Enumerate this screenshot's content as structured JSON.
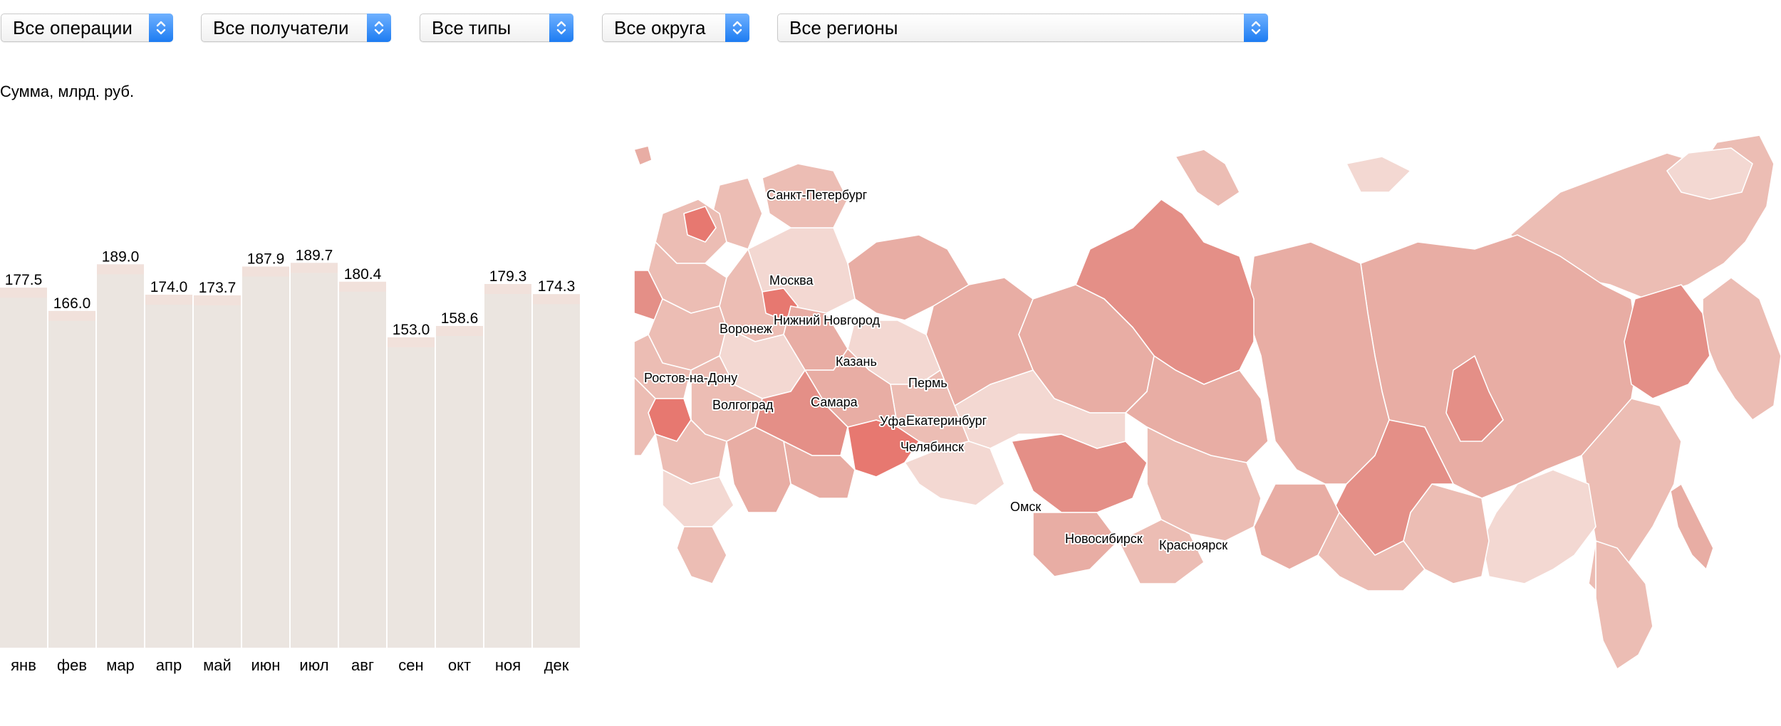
{
  "filters": {
    "operations": "Все операции",
    "recipients": "Все получатели",
    "types": "Все типы",
    "districts": "Все округа",
    "regions": "Все регионы"
  },
  "chart_data": {
    "type": "bar",
    "ylabel": "Сумма, млрд. руб.",
    "categories": [
      "янв",
      "фев",
      "мар",
      "апр",
      "май",
      "июн",
      "июл",
      "авг",
      "сен",
      "окт",
      "ноя",
      "дек"
    ],
    "values": [
      177.5,
      166.0,
      189.0,
      174.0,
      173.7,
      187.9,
      189.7,
      180.4,
      153.0,
      158.6,
      179.3,
      174.3
    ],
    "value_labels": [
      "177.5",
      "166.0",
      "189.0",
      "174.0",
      "173.7",
      "187.9",
      "189.7",
      "180.4",
      "153.0",
      "158.6",
      "179.3",
      "174.3"
    ]
  },
  "map": {
    "colors": {
      "lightest": "#f3d8d2",
      "light": "#ecbdb4",
      "medium": "#e8ada4",
      "dark": "#e48f87",
      "darkest": "#e77870"
    },
    "cities": [
      "Санкт-Петербург",
      "Москва",
      "Нижний Новгород",
      "Воронеж",
      "Казань",
      "Ростов-на-Дону",
      "Пермь",
      "Волгоград",
      "Самара",
      "Уфа",
      "Екатеринбург",
      "Челябинск",
      "Омск",
      "Новосибирск",
      "Красноярск"
    ]
  }
}
